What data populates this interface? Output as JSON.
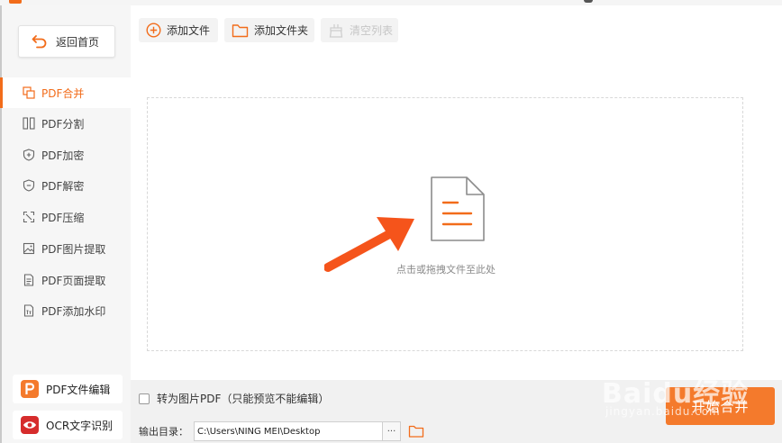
{
  "sidebar": {
    "back_label": "返回首页",
    "items": [
      {
        "label": "PDF合并",
        "icon": "merge-icon",
        "active": true
      },
      {
        "label": "PDF分割",
        "icon": "split-icon",
        "active": false
      },
      {
        "label": "PDF加密",
        "icon": "shield-plus-icon",
        "active": false
      },
      {
        "label": "PDF解密",
        "icon": "shield-minus-icon",
        "active": false
      },
      {
        "label": "PDF压缩",
        "icon": "compress-icon",
        "active": false
      },
      {
        "label": "PDF图片提取",
        "icon": "image-extract-icon",
        "active": false
      },
      {
        "label": "PDF页面提取",
        "icon": "page-extract-icon",
        "active": false
      },
      {
        "label": "PDF添加水印",
        "icon": "watermark-icon",
        "active": false
      }
    ],
    "tools": [
      {
        "label": "PDF文件编辑",
        "icon": "pdf-editor-icon",
        "color": "#f47a2c"
      },
      {
        "label": "OCR文字识别",
        "icon": "ocr-eye-icon",
        "color": "#d62c2c"
      }
    ]
  },
  "toolbar": {
    "add_file": "添加文件",
    "add_folder": "添加文件夹",
    "clear_list": "清空列表"
  },
  "dropzone": {
    "hint": "点击或拖拽文件至此处"
  },
  "options": {
    "convert_label": "转为图片PDF（只能预览不能编辑）",
    "convert_checked": false,
    "output_label": "输出目录：",
    "output_path": "C:\\Users\\NING MEI\\Desktop",
    "browse_label": "···"
  },
  "actions": {
    "start_label": "开始合并"
  },
  "watermark": {
    "main": "Baidu经验",
    "sub": "jingyan.baidu.com"
  },
  "colors": {
    "accent": "#f26c1a",
    "button": "#f47a2c"
  }
}
